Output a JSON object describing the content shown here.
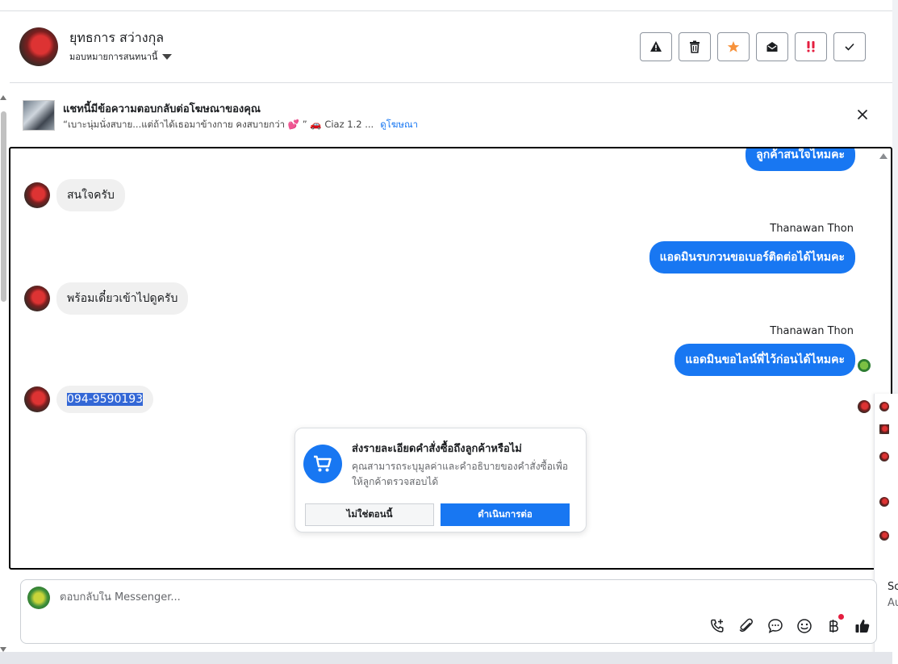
{
  "header": {
    "contact_name": "ยุทธการ สว่างกุล",
    "assign_label": "มอบหมายการสนทนานี้",
    "actions": [
      "spam",
      "delete",
      "star",
      "mark-unread",
      "urgent",
      "done"
    ]
  },
  "ad_banner": {
    "title": "แชทนี้มีข้อความตอบกลับต่อโฆษณาของคุณ",
    "snippet": "“เบาะนุ่มนั่งสบาย...แต่ถ้าได้เธอมาข้างกาย คงสบายกว่า 💕 ” 🚗 Ciaz 1.2 ...",
    "link_label": "ดูโฆษณา"
  },
  "messages": {
    "top_out": "ลูกค้าสนใจไหมคะ",
    "in_1": "สนใจครับ",
    "sender_1": "Thanawan Thon",
    "out_1": "แอดมินรบกวนขอเบอร์ติดต่อได้ไหมคะ",
    "in_2": "พร้อมเดี๋ยวเข้าไปดูครับ",
    "sender_2": "Thanawan Thon",
    "out_2": "แอดมินขอไลน์พี่ไว้ก่อนได้ไหมคะ",
    "in_3": "094-9590193"
  },
  "order_card": {
    "title": "ส่งรายละเอียดคำสั่งซื้อถึงลูกค้าหรือไม่",
    "description": "คุณสามารถระบุมูลค่าและคำอธิบายของคำสั่งซื้อเพื่อให้ลูกค้าตรวจสอบได้",
    "no_label": "ไม่ใช่ตอนนี้",
    "yes_label": "ดำเนินการต่อ"
  },
  "side_popup": {
    "text1": "Sc",
    "text2": "Au"
  },
  "composer": {
    "placeholder": "ตอบกลับใน Messenger..."
  },
  "colors": {
    "accent": "#1877f2",
    "bubble_in": "#f0f0f0",
    "urgent": "#e41e3f",
    "star": "#f7923b"
  }
}
